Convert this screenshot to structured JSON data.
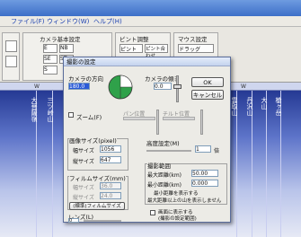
{
  "menu": [
    "ファイル(F)",
    "ウィンドウ(W)",
    "ヘルプ(H)"
  ],
  "ribbon_groups": [
    "カメラ基本設定",
    "ピント調整",
    "マウス設定"
  ],
  "ribbon_texts": {
    "g1a": "E",
    "g1b": "NB",
    "g1c": "SE",
    "g1d": "ST",
    "g1e": "S",
    "g2a": "ピント",
    "g2b": "ピント合わせ",
    "g3a": "ドラッグ"
  },
  "dialog": {
    "title": "撮影の設定",
    "camera_dir_label": "カメラの方向",
    "camera_dir_value": "180.0",
    "camera_tilt_label": "カメラの傾き",
    "camera_tilt_value": "0.0",
    "ok_button": "OK",
    "cancel_button": "キャンセル",
    "zoom_checkbox": "ズーム(F)",
    "pan_label": "パン位置",
    "tilt_label": "チルト位置",
    "image_size_label": "画像サイズ(pixel)",
    "width_label": "幅サイズ",
    "width_value": "1056",
    "height_label": "縦サイズ",
    "height_value": "647",
    "film_size_label": "フィルムサイズ(mm)",
    "film_w_label": "幅サイズ",
    "film_w_value": "36.0",
    "film_h_label": "縦サイズ",
    "film_h_value": "24.0",
    "film_button": "(標準)フィルムサイズ",
    "lens_label": "レンズ(L)",
    "lens_value": "0",
    "height_pos_label": "高度設定(M)",
    "height_pos_value": "1",
    "height_unit": "倍",
    "range_label": "撮影範囲",
    "max_dist_label": "最大距離(km)",
    "max_dist_value": "50.00",
    "min_dist_label": "最小距離(km)",
    "min_dist_value": "0.000",
    "note1": "最小距離を表示する",
    "note2": "最大距離以上の山を表示しません",
    "bottom_checkbox_line1": "画面に表示する",
    "bottom_checkbox_line2": "(撮影の設定範囲)"
  },
  "background_labels": [
    "大菩薩嶺",
    "三ツ峠山",
    "雲取山",
    "丹沢山",
    "大山",
    "槍ヶ岳"
  ],
  "ruler_ticks": [
    "W",
    "W",
    "W"
  ]
}
